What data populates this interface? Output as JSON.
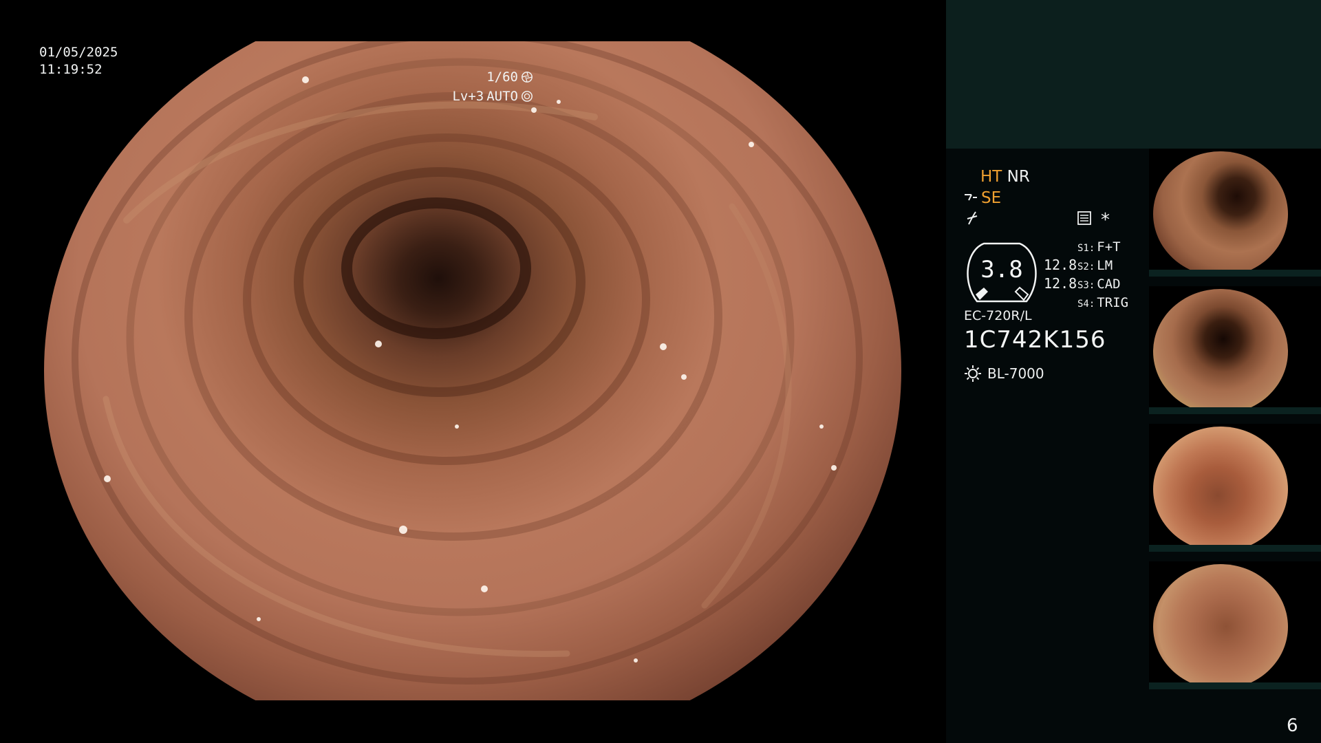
{
  "overlay": {
    "date": "01/05/2025",
    "time": "11:19:52",
    "shutter": "1/60",
    "shutter_icon": "shutter-icon",
    "level": "Lv+3",
    "auto": "AUTO",
    "auto_icon": "iris-icon"
  },
  "panel": {
    "mode_ht": "HT",
    "mode_nr": "NR",
    "mode_se": "SE",
    "star": "*",
    "gauge_value": "3.8",
    "gauge_side_top": "12.8",
    "gauge_side_bottom": "12.8",
    "settings": [
      {
        "key": "S1:",
        "value": "F+T"
      },
      {
        "key": "S2:",
        "value": "LM"
      },
      {
        "key": "S3:",
        "value": "CAD"
      },
      {
        "key": "S4:",
        "value": "TRIG"
      }
    ],
    "scope_model": "EC-720R/L",
    "scope_serial": "1C742K156",
    "light_source": "BL-7000",
    "page_number": "6"
  },
  "colors": {
    "accent_orange": "#f0a030",
    "panel_bg": "#03090a",
    "panel_top_bg": "#0c1f1d"
  },
  "thumbnails": [
    {
      "id": "thumb-1"
    },
    {
      "id": "thumb-2"
    },
    {
      "id": "thumb-3"
    },
    {
      "id": "thumb-4"
    }
  ]
}
